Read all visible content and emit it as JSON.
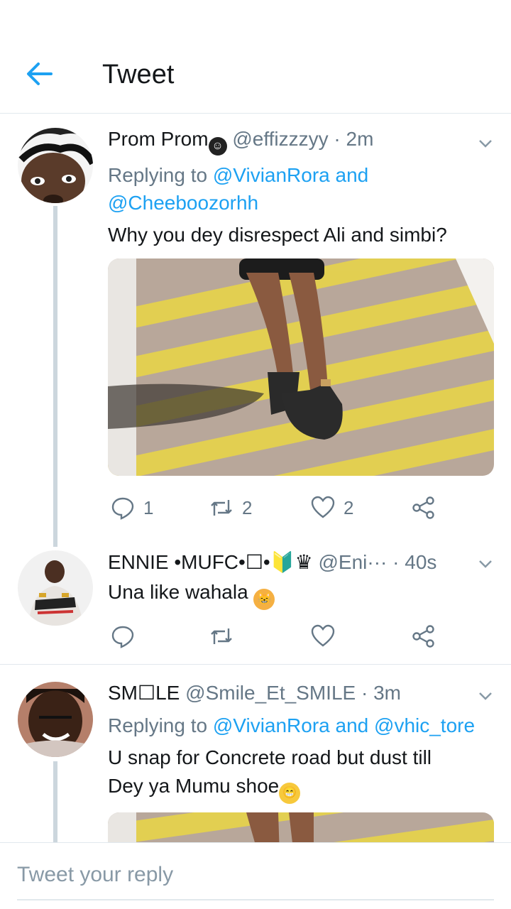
{
  "header": {
    "title": "Tweet"
  },
  "tweets": [
    {
      "display_name": "Prom Prom",
      "handle": "@effizzzyy",
      "time": "· 2m",
      "replying_prefix": "Replying to",
      "replying_mentions_1": "@VivianRora and",
      "replying_mentions_2": "@Cheeboozorhh",
      "text": "Why you dey disrespect Ali and simbi?",
      "replies": "1",
      "retweets": "2",
      "likes": "2"
    },
    {
      "display_name": "ENNIE •MUFC•☐•🔰♛",
      "handle": "@Eni···",
      "time": "· 40s",
      "text": "Una like wahala"
    },
    {
      "display_name": "SM☐LE",
      "handle": "@Smile_Et_SMILE",
      "time": "· 3m",
      "replying_prefix": "Replying to",
      "replying_mentions_1": "@VivianRora and @vhic_tore",
      "text_line1": "U snap for  Concrete road but dust till",
      "text_line2": "Dey ya Mumu shoe"
    }
  ],
  "compose": {
    "placeholder": "Tweet your reply"
  },
  "colors": {
    "accent": "#1da1f2",
    "secondary": "#657786",
    "line": "#e1e8ed"
  }
}
